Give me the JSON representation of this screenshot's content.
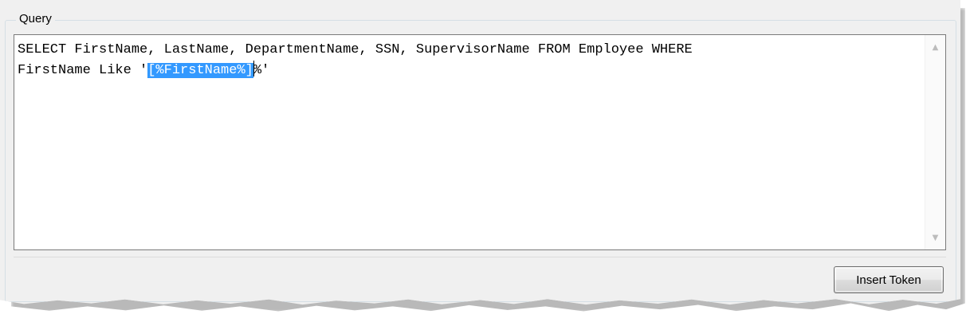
{
  "group": {
    "label": "Query"
  },
  "query": {
    "line1": "SELECT FirstName, LastName, DepartmentName, SSN, SupervisorName FROM Employee WHERE",
    "line2_before": "FirstName Like '",
    "line2_selected": "[%FirstName%]",
    "line2_after": "%'"
  },
  "scrollbar": {
    "up_icon": "triangle-up-icon",
    "down_icon": "triangle-down-icon"
  },
  "buttons": {
    "insert_token_label": "Insert Token"
  },
  "colors": {
    "selection": "#3399ff",
    "panel_background": "#f0f0f0"
  }
}
